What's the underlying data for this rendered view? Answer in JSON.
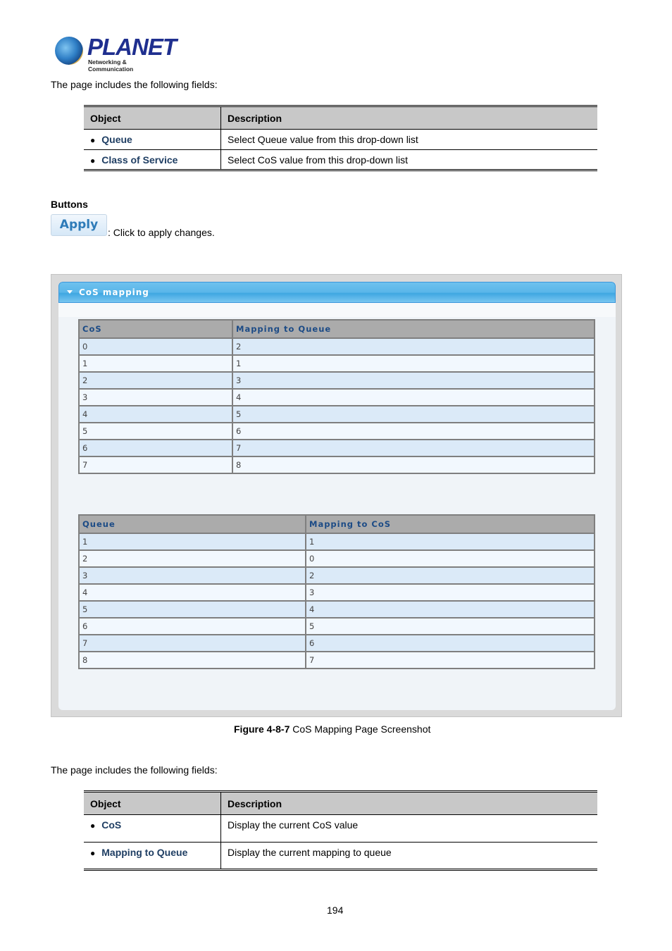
{
  "logo": {
    "brand": "PLANET",
    "tagline": "Networking & Communication"
  },
  "intro1": "The page includes the following fields:",
  "table1": {
    "headers": [
      "Object",
      "Description"
    ],
    "rows": [
      {
        "object": "Queue",
        "description": "Select Queue value from this drop-down list"
      },
      {
        "object": "Class of Service",
        "description": "Select CoS value from this drop-down list"
      }
    ]
  },
  "buttons_heading": "Buttons",
  "apply": {
    "label": "Apply",
    "description": ": Click to apply changes."
  },
  "screenshot": {
    "panel_title": "CoS mapping",
    "cos_table": {
      "headers": [
        "CoS",
        "Mapping to Queue"
      ],
      "rows": [
        [
          "0",
          "2"
        ],
        [
          "1",
          "1"
        ],
        [
          "2",
          "3"
        ],
        [
          "3",
          "4"
        ],
        [
          "4",
          "5"
        ],
        [
          "5",
          "6"
        ],
        [
          "6",
          "7"
        ],
        [
          "7",
          "8"
        ]
      ]
    },
    "queue_table": {
      "headers": [
        "Queue",
        "Mapping to CoS"
      ],
      "rows": [
        [
          "1",
          "1"
        ],
        [
          "2",
          "0"
        ],
        [
          "3",
          "2"
        ],
        [
          "4",
          "3"
        ],
        [
          "5",
          "4"
        ],
        [
          "6",
          "5"
        ],
        [
          "7",
          "6"
        ],
        [
          "8",
          "7"
        ]
      ]
    }
  },
  "caption": {
    "label": "Figure 4-8-7",
    "text": " CoS Mapping Page Screenshot"
  },
  "intro2": "The page includes the following fields:",
  "table2": {
    "headers": [
      "Object",
      "Description"
    ],
    "rows": [
      {
        "object": "CoS",
        "description": "Display the current CoS value"
      },
      {
        "object": "Mapping to Queue",
        "description": "Display the current mapping to queue"
      }
    ]
  },
  "page_number": "194"
}
